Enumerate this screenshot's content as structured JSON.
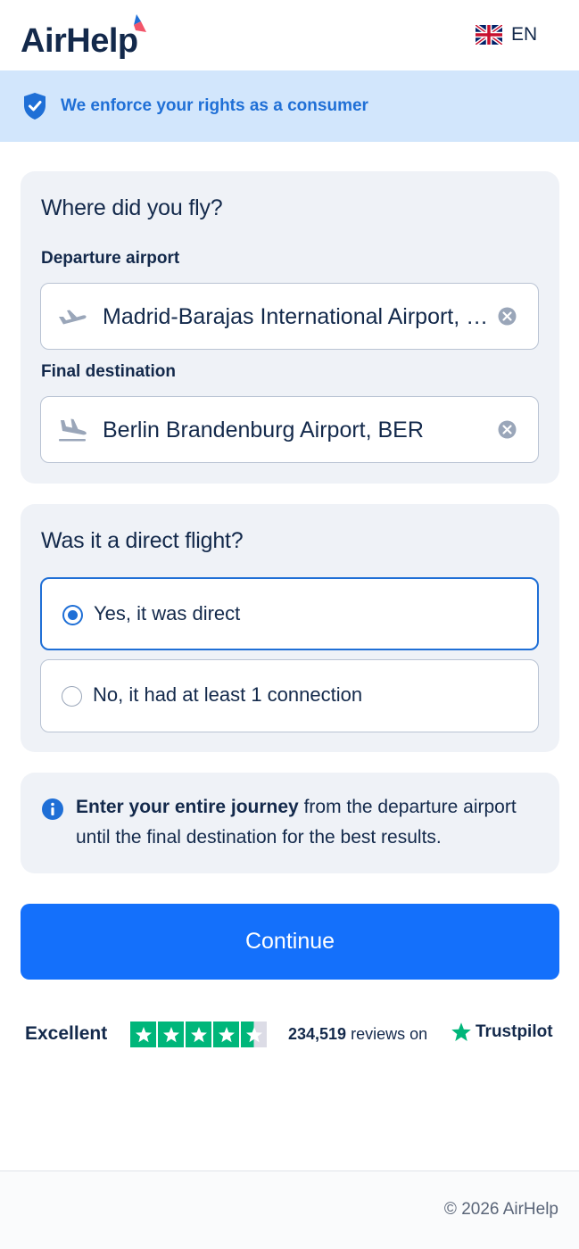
{
  "header": {
    "logo_text": "AirHelp",
    "language": "EN",
    "flag_icon": "uk-flag-icon"
  },
  "banner": {
    "icon": "shield-check-icon",
    "text": "We enforce your rights as a consumer"
  },
  "route": {
    "title": "Where did you fly?",
    "departure_label": "Departure airport",
    "departure_value": "Madrid-Barajas International Airport, MAD",
    "destination_label": "Final destination",
    "destination_value": "Berlin Brandenburg Airport, BER"
  },
  "direct": {
    "title": "Was it a direct flight?",
    "options": [
      {
        "label": "Yes, it was direct",
        "selected": true
      },
      {
        "label": "No, it had at least 1 connection",
        "selected": false
      }
    ]
  },
  "info": {
    "bold": "Enter your entire journey",
    "rest": " from the departure airport until the final destination for the best results."
  },
  "continue_label": "Continue",
  "trustpilot": {
    "rating_word": "Excellent",
    "stars": 4.5,
    "count": "234,519",
    "reviews_on": "reviews on",
    "brand": "Trustpilot"
  },
  "footer": {
    "copyright": "© 2026 AirHelp"
  },
  "colors": {
    "primary": "#1470fb",
    "navy": "#13294b",
    "banner_bg": "#d2e6fc",
    "card_bg": "#eff2f7",
    "trustpilot_green": "#00b67a"
  }
}
